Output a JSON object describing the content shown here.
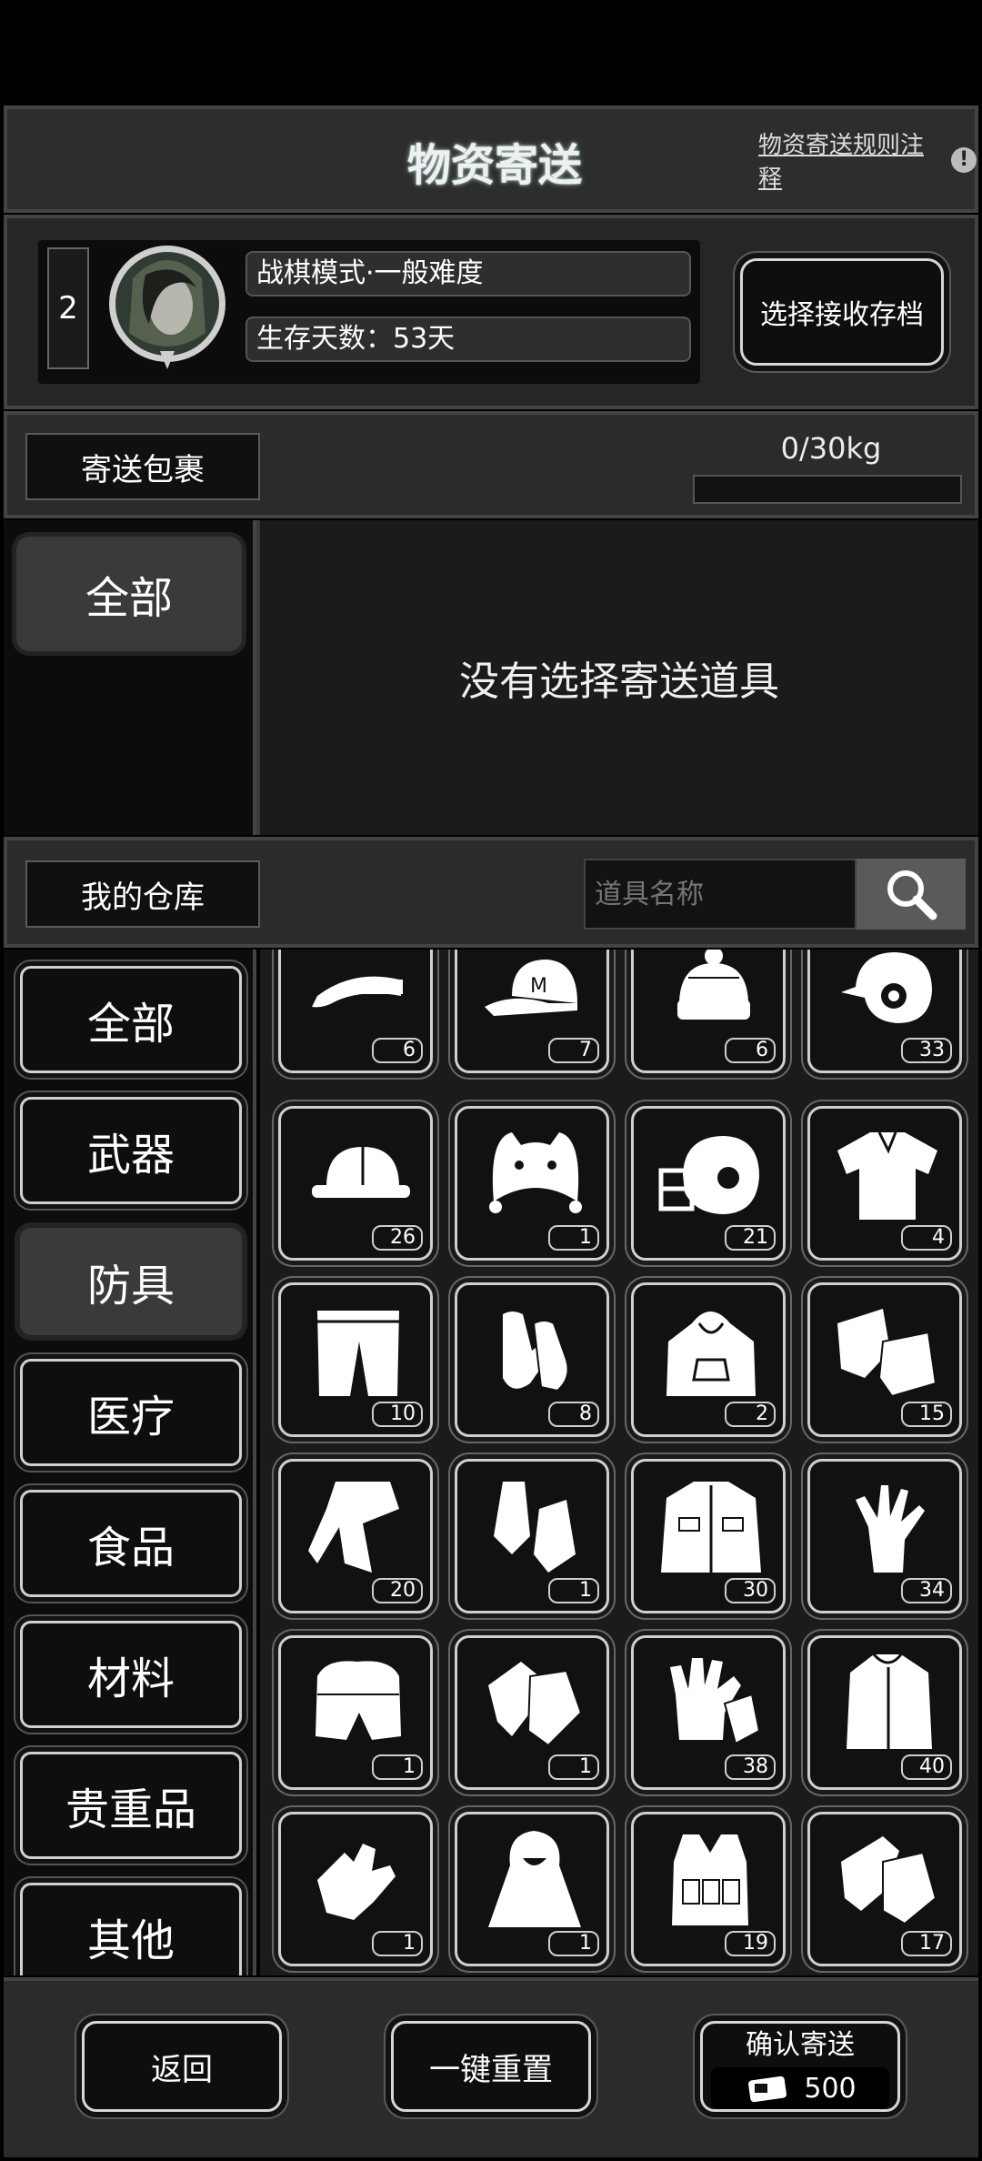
{
  "header": {
    "title": "物资寄送",
    "rules_link": "物资寄送规则注释"
  },
  "profile": {
    "slot_number": "2",
    "mode": "战棋模式·一般难度",
    "days": "生存天数：53天",
    "choose_button": "选择接收存档"
  },
  "package": {
    "label": "寄送包裹",
    "weight": "0/30kg",
    "weight_fraction": 0
  },
  "package_tabs": [
    "全部"
  ],
  "empty_message": "没有选择寄送道具",
  "warehouse": {
    "label": "我的仓库",
    "search_placeholder": "道具名称"
  },
  "categories": [
    "全部",
    "武器",
    "防具",
    "医疗",
    "食品",
    "材料",
    "贵重品",
    "其他"
  ],
  "selected_category": "防具",
  "items": [
    {
      "icon": "visor-icon",
      "count": "6"
    },
    {
      "icon": "baseball-cap-icon",
      "count": "7"
    },
    {
      "icon": "beanie-icon",
      "count": "6"
    },
    {
      "icon": "batting-helmet-icon",
      "count": "33"
    },
    {
      "icon": "hard-hat-icon",
      "count": "26"
    },
    {
      "icon": "animal-hat-icon",
      "count": "1"
    },
    {
      "icon": "football-helmet-icon",
      "count": "21"
    },
    {
      "icon": "shirt-icon",
      "count": "4"
    },
    {
      "icon": "pants-icon",
      "count": "10"
    },
    {
      "icon": "gloves-icon",
      "count": "8"
    },
    {
      "icon": "hoodie-icon",
      "count": "2"
    },
    {
      "icon": "fingerless-gloves-icon",
      "count": "15"
    },
    {
      "icon": "tracksuit-icon",
      "count": "20"
    },
    {
      "icon": "arm-warmers-icon",
      "count": "1"
    },
    {
      "icon": "jacket-icon",
      "count": "30"
    },
    {
      "icon": "glove-icon",
      "count": "34"
    },
    {
      "icon": "fur-pants-icon",
      "count": "1"
    },
    {
      "icon": "knit-gloves-icon",
      "count": "1"
    },
    {
      "icon": "tactical-gloves-icon",
      "count": "38"
    },
    {
      "icon": "coat-icon",
      "count": "40"
    },
    {
      "icon": "fingerless-glove-icon",
      "count": "1"
    },
    {
      "icon": "cloak-icon",
      "count": "1"
    },
    {
      "icon": "tactical-vest-icon",
      "count": "19"
    },
    {
      "icon": "combat-gloves-icon",
      "count": "17"
    }
  ],
  "footer": {
    "back": "返回",
    "reset": "一键重置",
    "confirm": "确认寄送",
    "cost": "500"
  }
}
